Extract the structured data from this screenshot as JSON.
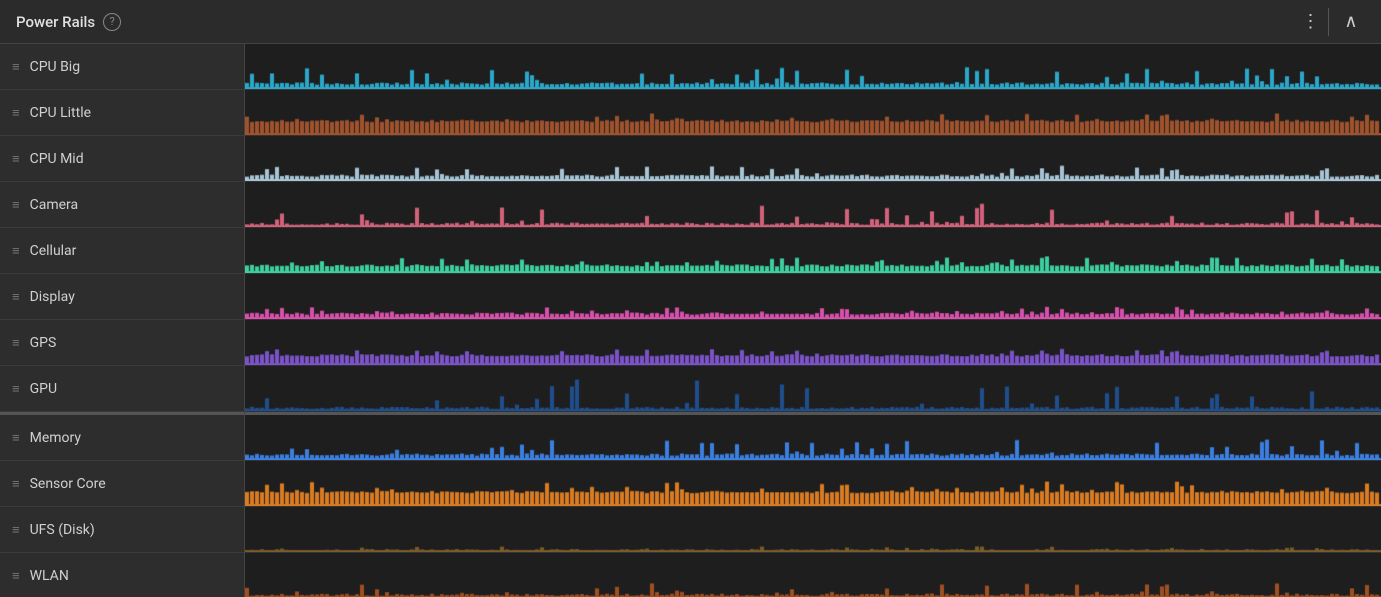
{
  "header": {
    "title": "Power Rails",
    "help_label": "?",
    "more_icon": "⋮",
    "collapse_icon": "∧"
  },
  "sidebar": {
    "items": [
      {
        "label": "CPU Big",
        "color": "#29a8c9"
      },
      {
        "label": "CPU Little",
        "color": "#a0522d"
      },
      {
        "label": "CPU Mid",
        "color": "#a8c4d4"
      },
      {
        "label": "Camera",
        "color": "#d4617a"
      },
      {
        "label": "Cellular",
        "color": "#3dcfa0"
      },
      {
        "label": "Display",
        "color": "#d94fad"
      },
      {
        "label": "GPS",
        "color": "#7b52c8"
      },
      {
        "label": "GPU",
        "color": "#1e4f8c"
      },
      {
        "label": "Memory",
        "color": "#3b7fe0"
      },
      {
        "label": "Sensor Core",
        "color": "#d97b20"
      },
      {
        "label": "UFS (Disk)",
        "color": "#7a5c2a"
      },
      {
        "label": "WLAN",
        "color": "#a05020"
      }
    ]
  },
  "charts": {
    "colors": {
      "cpu_big": "#29a8c9",
      "cpu_little": "#a05020",
      "cpu_mid": "#a8c4d4",
      "camera": "#d4617a",
      "cellular": "#3dcfa0",
      "display": "#d94fad",
      "gps": "#7b52c8",
      "gpu": "#1e4f8c",
      "memory": "#3b7fe0",
      "sensor_core": "#d97b20",
      "ufs_disk": "#7a5c2a",
      "wlan": "#a05020"
    }
  }
}
